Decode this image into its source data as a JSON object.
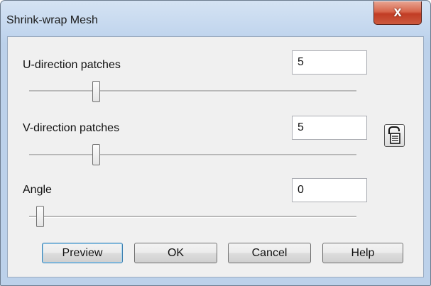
{
  "window": {
    "title": "Shrink-wrap Mesh",
    "close_glyph": "x"
  },
  "u_patches": {
    "label": "U-direction patches",
    "value": "5",
    "slider_fraction": 0.19
  },
  "v_patches": {
    "label": "V-direction patches",
    "value": "5",
    "slider_fraction": 0.19
  },
  "angle": {
    "label": "Angle",
    "value": "0",
    "slider_fraction": 0.0
  },
  "lock": {
    "icon": "lock-icon"
  },
  "buttons": {
    "preview": "Preview",
    "ok": "OK",
    "cancel": "Cancel",
    "help": "Help"
  }
}
